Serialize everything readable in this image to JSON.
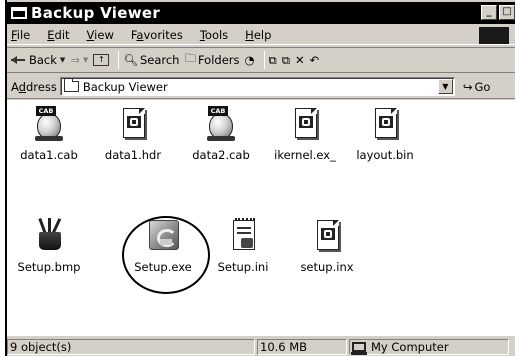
{
  "window": {
    "title": "Backup Viewer",
    "buttons": [
      "_",
      "□"
    ]
  },
  "menu": [
    {
      "label": "File",
      "key": "F",
      "rest": "ile"
    },
    {
      "label": "Edit",
      "key": "E",
      "rest": "dit"
    },
    {
      "label": "View",
      "key": "V",
      "rest": "iew"
    },
    {
      "label": "Favorites",
      "pre": "F",
      "key": "a",
      "rest": "vorites"
    },
    {
      "label": "Tools",
      "key": "T",
      "rest": "ools"
    },
    {
      "label": "Help",
      "key": "H",
      "rest": "elp"
    }
  ],
  "toolbar": {
    "back_label": "Back",
    "search_label": "Search",
    "folders_label": "Folders"
  },
  "address": {
    "label_pre": "A",
    "label_key": "d",
    "label_rest": "dress",
    "value": "Backup Viewer",
    "go_label": "Go"
  },
  "files": [
    {
      "name": "data1.cab",
      "icon": "cab-icon"
    },
    {
      "name": "data1.hdr",
      "icon": "document-icon"
    },
    {
      "name": "data2.cab",
      "icon": "cab-icon"
    },
    {
      "name": "ikernel.ex_",
      "icon": "document-icon"
    },
    {
      "name": "layout.bin",
      "icon": "document-icon"
    },
    {
      "name": "Setup.bmp",
      "icon": "paint-icon"
    },
    {
      "name": "Setup.exe",
      "icon": "installer-icon"
    },
    {
      "name": "Setup.ini",
      "icon": "config-icon"
    },
    {
      "name": "setup.inx",
      "icon": "document-icon"
    }
  ],
  "cab_tag": "CAB",
  "status": {
    "objects": "9 object(s)",
    "size": "10.6 MB",
    "zone": "My Computer"
  }
}
